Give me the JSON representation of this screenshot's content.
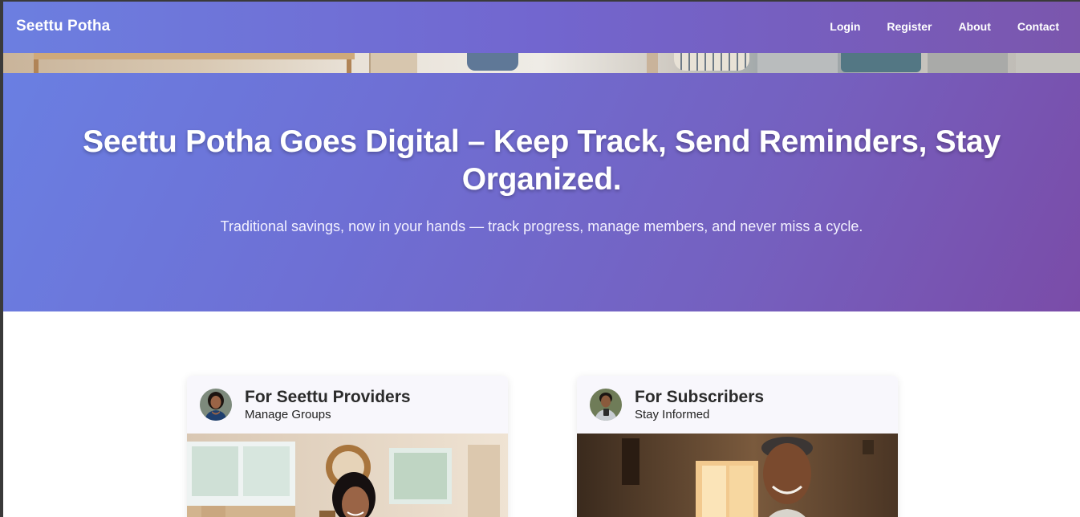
{
  "navbar": {
    "brand": "Seettu Potha",
    "links": [
      {
        "label": "Login"
      },
      {
        "label": "Register"
      },
      {
        "label": "About"
      },
      {
        "label": "Contact"
      }
    ]
  },
  "hero": {
    "title": "Seettu Potha Goes Digital – Keep Track, Send Reminders, Stay Organized.",
    "subtitle": "Traditional savings, now in your hands — track progress, manage members, and never miss a cycle."
  },
  "cards": [
    {
      "title": "For Seettu Providers",
      "subtitle": "Manage Groups",
      "avatar_icon": "woman-avatar",
      "photo_icon": "woman-at-home-photo"
    },
    {
      "title": "For Subscribers",
      "subtitle": "Stay Informed",
      "avatar_icon": "man-avatar",
      "photo_icon": "man-with-phone-photo"
    }
  ],
  "colors": {
    "gradient_start": "#6a7fe2",
    "gradient_end": "#7a4ca8",
    "card_header_bg": "#f8f7fc"
  }
}
